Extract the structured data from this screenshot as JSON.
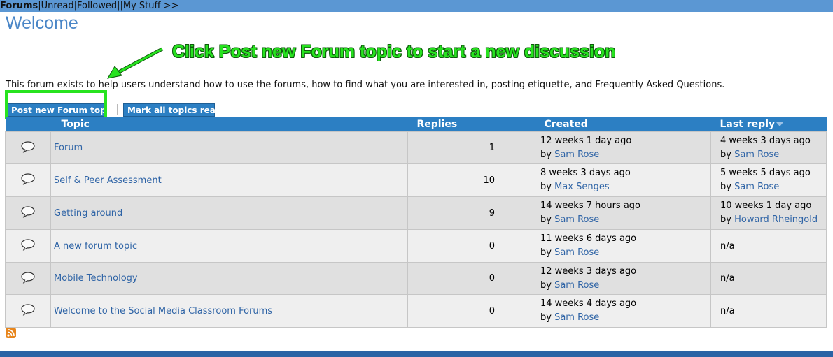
{
  "topnav": [
    {
      "label": "Forums",
      "active": true
    },
    {
      "label": "Unread"
    },
    {
      "label": "Followed"
    },
    {
      "label": ""
    },
    {
      "label": "My Stuff >>"
    }
  ],
  "page_title": "Welcome",
  "annotation": "Click Post new Forum topic to start a new discussion",
  "intro": "This forum exists to help users understand how to use the forums, how to find what you are interested in, posting etiquette, and Frequently Asked Questions.",
  "buttons": {
    "post_new": "Post new Forum topic",
    "mark_read": "Mark all topics read"
  },
  "table": {
    "headers": {
      "topic": "Topic",
      "replies": "Replies",
      "created": "Created",
      "last_reply": "Last reply"
    },
    "rows": [
      {
        "topic": "Forum",
        "replies": "1",
        "created": "12 weeks 1 day ago",
        "created_by": "Sam Rose",
        "last": "4 weeks 3 days ago",
        "last_by": "Sam Rose"
      },
      {
        "topic": "Self & Peer Assessment",
        "replies": "10",
        "created": "8 weeks 3 days ago",
        "created_by": "Max Senges",
        "last": "5 weeks 5 days ago",
        "last_by": "Sam Rose"
      },
      {
        "topic": "Getting around",
        "replies": "9",
        "created": "14 weeks 7 hours ago",
        "created_by": "Sam Rose",
        "last": "10 weeks 1 day ago",
        "last_by": "Howard Rheingold"
      },
      {
        "topic": "A new forum topic",
        "replies": "0",
        "created": "11 weeks 6 days ago",
        "created_by": "Sam Rose",
        "last": "n/a",
        "last_by": ""
      },
      {
        "topic": "Mobile Technology",
        "replies": "0",
        "created": "12 weeks 3 days ago",
        "created_by": "Sam Rose",
        "last": "n/a",
        "last_by": ""
      },
      {
        "topic": "Welcome to the Social Media Classroom Forums",
        "replies": "0",
        "created": "14 weeks 4 days ago",
        "created_by": "Sam Rose",
        "last": "n/a",
        "last_by": ""
      }
    ],
    "by_prefix": "by"
  },
  "colors": {
    "accent": "#2c7fc3",
    "highlight": "#27e31f",
    "link": "#2f64a6"
  }
}
